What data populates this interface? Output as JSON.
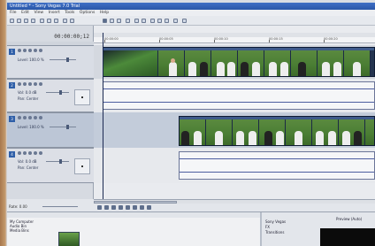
{
  "window": {
    "title": "Untitled * - Sony Vegas 7.0 Trial"
  },
  "menu": [
    "File",
    "Edit",
    "View",
    "Insert",
    "Tools",
    "Options",
    "Help"
  ],
  "timecode": "00:00:00;12",
  "ruler": {
    "marks": [
      "00:00:00",
      "00:00:05",
      "00:00:10",
      "00:00:15",
      "00:00:20",
      "00:00:25"
    ]
  },
  "tracks": [
    {
      "number": "1",
      "kind": "video",
      "level_label": "Level: 100.0 %"
    },
    {
      "number": "2",
      "kind": "audio",
      "vol_label": "Vol:",
      "vol_value": "0.0 dB",
      "pan_label": "Pan:",
      "pan_value": "Center"
    },
    {
      "number": "3",
      "kind": "video",
      "level_label": "Level: 100.0 %"
    },
    {
      "number": "4",
      "kind": "audio",
      "vol_label": "Vol:",
      "vol_value": "0.0 dB",
      "pan_label": "Pan:",
      "pan_value": "Center"
    }
  ],
  "rate": "Rate: 0.00",
  "explorer": {
    "tree": [
      "My Computer",
      "Audio Bin",
      "Media Bins"
    ]
  },
  "right_pane": {
    "items": [
      "Sony Vegas",
      "FX",
      "Transitions"
    ],
    "preview_label": "Preview (Auto)"
  },
  "colors": {
    "accent": "#2f5fa8",
    "title_bar": "#3f6fc6",
    "clip": "#24344f"
  }
}
